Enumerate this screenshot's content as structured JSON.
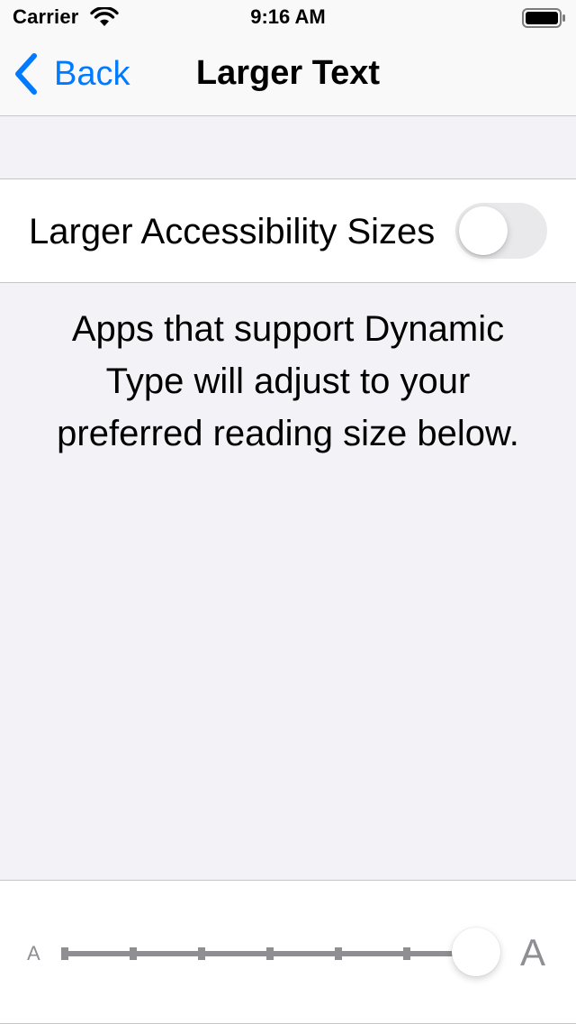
{
  "status_bar": {
    "carrier": "Carrier",
    "time": "9:16 AM",
    "wifi_icon": "wifi-icon",
    "battery_icon": "battery-icon"
  },
  "nav": {
    "back_label": "Back",
    "back_icon": "chevron-left-icon",
    "title": "Larger Text"
  },
  "toggle": {
    "label": "Larger Accessibility Sizes",
    "on": false
  },
  "description": "Apps that support Dynamic Type will adjust to your preferred reading size below.",
  "slider": {
    "min_label": "A",
    "max_label": "A",
    "positions": 7,
    "selected_index": 6
  },
  "colors": {
    "accent": "#007aff",
    "background": "#f2f2f7",
    "separator": "#c6c6c8",
    "secondary": "#8e8e93"
  }
}
